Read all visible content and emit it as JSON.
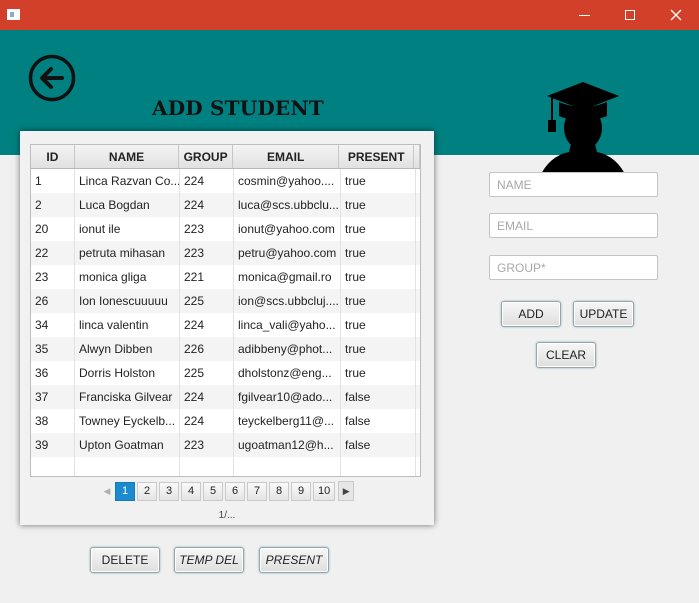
{
  "window": {
    "minimize_label": "",
    "maximize_label": "",
    "close_label": ""
  },
  "header": {
    "title": "ADD STUDENT",
    "back_icon": "back-arrow-circle-icon",
    "logo_icon": "graduate-silhouette-icon",
    "background_color": "#008080"
  },
  "table": {
    "columns": [
      "ID",
      "NAME",
      "GROUP",
      "EMAIL",
      "PRESENT"
    ],
    "rows": [
      {
        "id": "1",
        "name": "Linca Razvan Co...",
        "group": "224",
        "email": "cosmin@yahoo....",
        "present": "true"
      },
      {
        "id": "2",
        "name": "Luca Bogdan",
        "group": "224",
        "email": "luca@scs.ubbclu...",
        "present": "true"
      },
      {
        "id": "20",
        "name": "ionut ile",
        "group": "223",
        "email": "ionut@yahoo.com",
        "present": "true"
      },
      {
        "id": "22",
        "name": "petruta mihasan",
        "group": "223",
        "email": "petru@yahoo.com",
        "present": "true"
      },
      {
        "id": "23",
        "name": "monica gliga",
        "group": "221",
        "email": "monica@gmail.ro",
        "present": "true"
      },
      {
        "id": "26",
        "name": "Ion Ionescuuuuu",
        "group": "225",
        "email": "ion@scs.ubbcluj....",
        "present": "true"
      },
      {
        "id": "34",
        "name": "linca valentin",
        "group": "224",
        "email": "linca_vali@yaho...",
        "present": "true"
      },
      {
        "id": "35",
        "name": "Alwyn Dibben",
        "group": "226",
        "email": "adibbeny@phot...",
        "present": "true"
      },
      {
        "id": "36",
        "name": "Dorris Holston",
        "group": "225",
        "email": "dholstonz@eng...",
        "present": "true"
      },
      {
        "id": "37",
        "name": "Franciska Gilvear",
        "group": "224",
        "email": "fgilvear10@ado...",
        "present": "false"
      },
      {
        "id": "38",
        "name": "Towney Eyckelb...",
        "group": "224",
        "email": "teyckelberg11@...",
        "present": "false"
      },
      {
        "id": "39",
        "name": "Upton Goatman",
        "group": "223",
        "email": "ugoatman12@h...",
        "present": "false"
      }
    ]
  },
  "pagination": {
    "pages": [
      "1",
      "2",
      "3",
      "4",
      "5",
      "6",
      "7",
      "8",
      "9",
      "10"
    ],
    "current_page": "1",
    "info": "1/...",
    "accent_color": "#1a8bcf"
  },
  "form": {
    "name_placeholder": "NAME",
    "email_placeholder": "EMAIL",
    "group_placeholder": "GROUP*",
    "add_label": "ADD",
    "update_label": "UPDATE",
    "clear_label": "CLEAR"
  },
  "actions": {
    "delete_label": "DELETE",
    "temp_del_label": "TEMP DEL",
    "present_label": "PRESENT"
  }
}
